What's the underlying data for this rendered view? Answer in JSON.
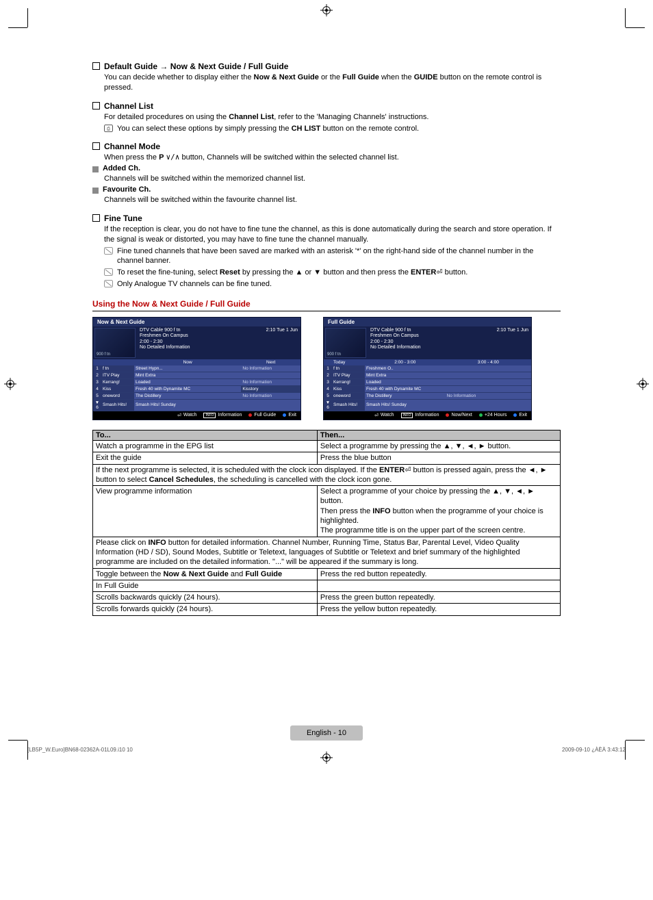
{
  "sections": {
    "defaultGuide": {
      "title_pre": "Default Guide",
      "title_post": "Now & Next Guide / Full Guide",
      "body": "You can decide whether to display either the",
      "b1": "Now & Next Guide",
      "mid1": "or the",
      "b2": "Full Guide",
      "mid2": "when the",
      "b3": "GUIDE",
      "tail": "button on the remote control is pressed."
    },
    "channelList": {
      "title": "Channel List",
      "body_pre": "For detailed procedures on using the",
      "b1": "Channel List",
      "body_post": ", refer to the 'Managing Channels' instructions.",
      "note_pre": "You can select these options by simply pressing the",
      "note_b": "CH LIST",
      "note_post": "button on the remote control."
    },
    "channelMode": {
      "title": "Channel Mode",
      "body_pre": "When press the",
      "body_b": "P",
      "body_post": "button, Channels will be switched within the selected channel list.",
      "added_title": "Added Ch.",
      "added_body": "Channels will be switched within the memorized channel list.",
      "fav_title": "Favourite Ch.",
      "fav_body": "Channels will be switched within the favourite channel list."
    },
    "fineTune": {
      "title": "Fine Tune",
      "body1": "If the reception is clear, you do not have to fine tune the channel, as this is done automatically during the search and store operation. If the signal is weak or distorted, you may have to fine tune the channel manually.",
      "n1": "Fine tuned channels that have been saved are marked with an asterisk '*' on the right-hand side of the channel number in the channel banner.",
      "n2_pre": "To reset the fine-tuning, select",
      "n2_b1": "Reset",
      "n2_mid": "by pressing the ▲ or ▼ button and then press the",
      "n2_b2": "ENTER",
      "n2_post": "button.",
      "n3": "Only Analogue TV channels can be fine tuned."
    }
  },
  "usingTitle": "Using the Now & Next Guide / Full Guide",
  "guideCards": {
    "now": {
      "hdr": "Now & Next Guide",
      "ch": "DTV Cable 900 f tn",
      "time": "2:10  Tue 1 Jun",
      "prog": "Freshmen On Campus",
      "span": "2:00 - 2:30",
      "noinfo": "No Detailed Information",
      "chno": "900 f tn",
      "cols": [
        "",
        "",
        "Now",
        "Next"
      ],
      "rows": [
        [
          "1",
          "f tn",
          "Street Hypn...",
          "No Information"
        ],
        [
          "2",
          "ITV Play",
          "Mint Extra",
          ""
        ],
        [
          "3",
          "Kerrang!",
          "Loaded",
          "No Information"
        ],
        [
          "4",
          "Kiss",
          "Fresh 40 with Dynamite MC",
          "Kisstory"
        ],
        [
          "5",
          "oneword",
          "The Distillery",
          "No Information"
        ],
        [
          "▼ 6",
          "Smash Hits!",
          "Smash Hits! Sunday",
          ""
        ]
      ],
      "foot": [
        "Watch",
        "Information",
        "Full Guide",
        "Exit"
      ]
    },
    "full": {
      "hdr": "Full Guide",
      "ch": "DTV Cable 900 f tn",
      "time": "2:10  Tue 1 Jun",
      "prog": "Freshmen On Campus",
      "span": "2:00 - 2:30",
      "noinfo": "No Detailed Information",
      "chno": "900 f tn",
      "cols": [
        "",
        "Today",
        "2:00 - 3:00",
        "3:00 - 4:00"
      ],
      "rows": [
        [
          "1",
          "f tn",
          "Freshmen O..",
          ""
        ],
        [
          "2",
          "ITV Play",
          "Mint Extra",
          ""
        ],
        [
          "3",
          "Kerrang!",
          "Loaded",
          ""
        ],
        [
          "4",
          "Kiss",
          "Fresh 40 with Dynamite MC",
          ""
        ],
        [
          "5",
          "oneword",
          "The Distillery",
          "No Information"
        ],
        [
          "▼ 6",
          "Smash Hits!",
          "Smash Hits! Sunday",
          ""
        ]
      ],
      "foot": [
        "Watch",
        "Information",
        "Now/Next",
        "+24 Hours",
        "Exit"
      ]
    }
  },
  "table": {
    "h1": "To...",
    "h2": "Then...",
    "rows": [
      {
        "a": "Watch a programme in the EPG list",
        "b": "Select a programme by pressing the ▲, ▼, ◄, ► button."
      },
      {
        "a": "Exit the guide",
        "b": "Press the blue button"
      }
    ],
    "span1_pre": "If the next programme is selected, it is scheduled with the clock icon displayed. If the",
    "span1_b": "ENTER",
    "span1_mid": "button is pressed again, press the ◄, ► button to select",
    "span1_b2": "Cancel Schedules",
    "span1_post": ", the scheduling is cancelled with the clock icon gone.",
    "row3a": "View programme information",
    "row3b_l1": "Select a programme of your choice by pressing the ▲, ▼, ◄, ► button.",
    "row3b_l2_pre": "Then press the",
    "row3b_l2_b": "INFO",
    "row3b_l2_post": "button when the programme of your choice is highlighted.",
    "row3b_l3": "The programme title is on the upper part of the screen centre.",
    "span2_pre": "Please click on",
    "span2_b": "INFO",
    "span2_post": "button for detailed information. Channel Number, Running Time, Status Bar, Parental Level, Video Quality Information (HD / SD), Sound Modes, Subtitle or Teletext, languages of Subtitle or Teletext and brief summary of the highlighted programme are included on the detailed information. \"...\" will be appeared if the summary is long.",
    "row4a_pre": "Toggle between the",
    "row4a_b1": "Now & Next Guide",
    "row4a_mid": "and",
    "row4a_b2": "Full Guide",
    "row4b": "Press the red button repeatedly.",
    "row5a": "In Full Guide",
    "row6a": "Scrolls backwards quickly (24 hours).",
    "row6b": "Press the green button repeatedly.",
    "row7a": "Scrolls forwards quickly (24 hours).",
    "row7b": "Press the yellow button repeatedly."
  },
  "footer": {
    "page": "English - 10",
    "leftCode": "[LB5P_W.Euro]BN68-02362A-01L09.i10   10",
    "rightCode": "2009-09-10   ¿ÀÈÄ 3:43:12"
  }
}
